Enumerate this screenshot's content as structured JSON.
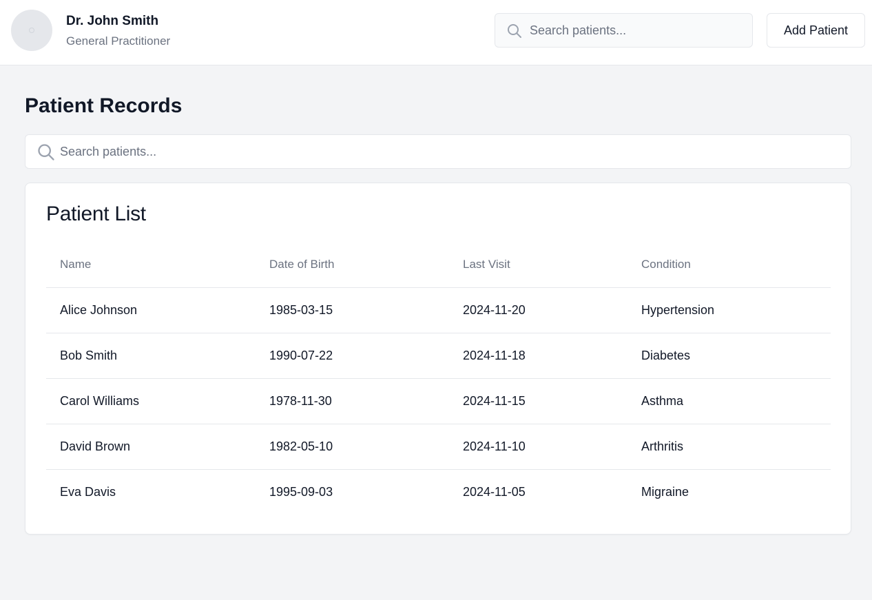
{
  "header": {
    "doctor_name": "Dr. John Smith",
    "doctor_title": "General Practitioner",
    "search_placeholder": "Search patients...",
    "add_button_label": "Add Patient"
  },
  "main": {
    "title": "Patient Records",
    "search_placeholder": "Search patients..."
  },
  "patient_list": {
    "title": "Patient List",
    "columns": [
      "Name",
      "Date of Birth",
      "Last Visit",
      "Condition"
    ],
    "rows": [
      [
        "Alice Johnson",
        "1985-03-15",
        "2024-11-20",
        "Hypertension"
      ],
      [
        "Bob Smith",
        "1990-07-22",
        "2024-11-18",
        "Diabetes"
      ],
      [
        "Carol Williams",
        "1978-11-30",
        "2024-11-15",
        "Asthma"
      ],
      [
        "David Brown",
        "1982-05-10",
        "2024-11-10",
        "Arthritis"
      ],
      [
        "Eva Davis",
        "1995-09-03",
        "2024-11-05",
        "Migraine"
      ]
    ]
  },
  "icons": {
    "header_search": "search-icon",
    "main_search": "search-icon",
    "avatar": "avatar-placeholder"
  },
  "colors": {
    "page_background": "#f3f4f6",
    "surface": "#ffffff",
    "border": "#e5e7eb",
    "text_primary": "#111827",
    "text_muted": "#6b7280"
  }
}
